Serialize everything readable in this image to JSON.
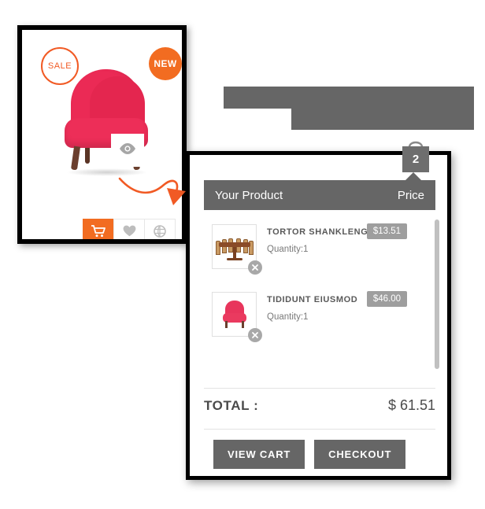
{
  "product_card": {
    "badge_sale": "SALE",
    "badge_new": "NEW",
    "quickview_icon": "eye-icon",
    "actions": [
      {
        "name": "add-to-cart",
        "icon": "cart-icon",
        "primary": true
      },
      {
        "name": "wishlist",
        "icon": "heart-icon",
        "primary": false
      },
      {
        "name": "compare",
        "icon": "compare-icon",
        "primary": false
      }
    ],
    "arrow_icon": "curved-arrow-icon",
    "product_image": "pink-armchair"
  },
  "cart": {
    "bag_icon": "shopping-bag-icon",
    "bag_count": "2",
    "header": {
      "product_column": "Your Product",
      "price_column": "Price"
    },
    "items": [
      {
        "name": "TORTOR SHANKLENG",
        "quantity_label": "Quantity:1",
        "price": "$13.51",
        "thumbnail": "dining-table-set",
        "remove_icon": "remove-x-icon"
      },
      {
        "name": "TIDIDUNT EIUSMOD",
        "quantity_label": "Quantity:1",
        "price": "$46.00",
        "thumbnail": "pink-armchair",
        "remove_icon": "remove-x-icon"
      }
    ],
    "total_label": "TOTAL :",
    "total_value": "$ 61.51",
    "view_cart_label": "VIEW CART",
    "checkout_label": "CHECKOUT"
  },
  "colors": {
    "orange": "#f26c21",
    "sale_orange": "#f15a24",
    "grey_dark": "#666666",
    "grey_badge": "#9e9e9e",
    "pink": "#eb2a55"
  }
}
